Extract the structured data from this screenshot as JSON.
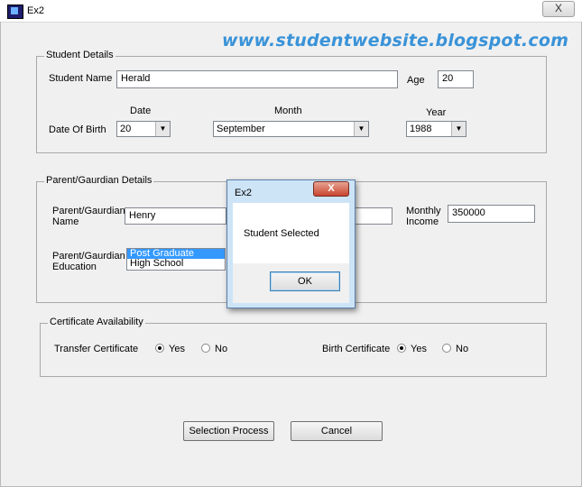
{
  "window": {
    "title": "Ex2",
    "close_glyph": "X"
  },
  "watermark": "www.studentwebsite.blogspot.com",
  "student": {
    "legend": "Student Details",
    "name_label": "Student Name",
    "name_value": "Herald",
    "age_label": "Age",
    "age_value": "20",
    "dob_label": "Date Of Birth",
    "date_header": "Date",
    "month_header": "Month",
    "year_header": "Year",
    "date_value": "20",
    "month_value": "September",
    "year_value": "1988"
  },
  "parent": {
    "legend": "Parent/Gaurdian Details",
    "name_label_1": "Parent/Gaurdian",
    "name_label_2": "Name",
    "name_value": "Henry",
    "income_label_1": "Monthly",
    "income_label_2": "Income",
    "income_value": "350000",
    "edu_label_1": "Parent/Gaurdian",
    "edu_label_2": "Education",
    "education_options": [
      "Post Graduate",
      "High School"
    ],
    "education_selected_index": 0
  },
  "certificates": {
    "legend": "Certificate Availability",
    "transfer_label": "Transfer Certificate",
    "birth_label": "Birth Certificate",
    "yes_label": "Yes",
    "no_label": "No",
    "transfer_selected": "Yes",
    "birth_selected": "Yes"
  },
  "buttons": {
    "selection": "Selection Process",
    "cancel": "Cancel"
  },
  "dialog": {
    "title": "Ex2",
    "close_glyph": "X",
    "message": "Student Selected",
    "ok": "OK"
  },
  "colors": {
    "selection_highlight": "#3399ff",
    "watermark": "#3a93d8",
    "dialog_frame": "#cde4f7",
    "dialog_close": "#c7452f"
  }
}
